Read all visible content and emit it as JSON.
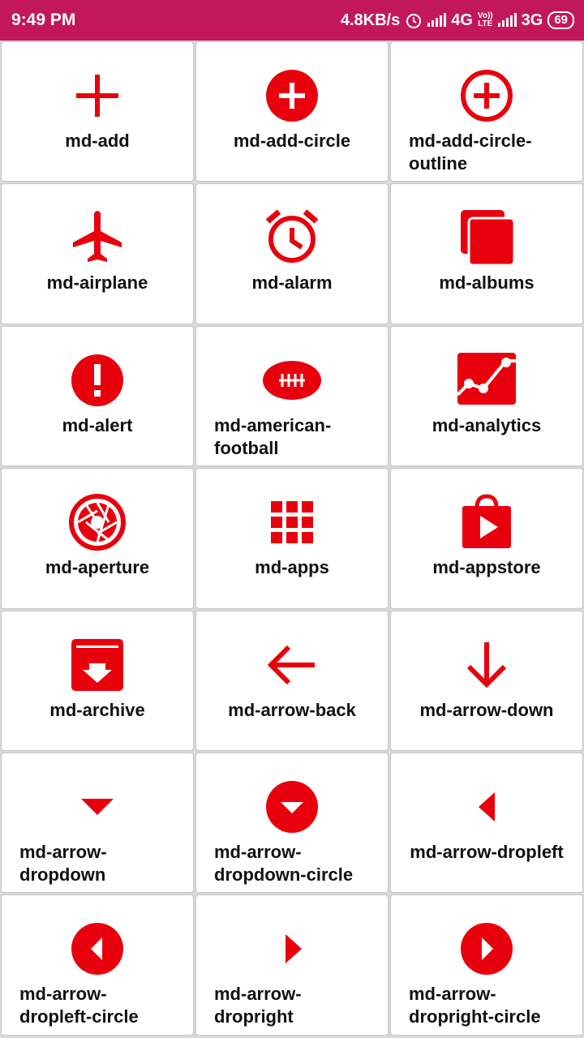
{
  "status_bar": {
    "time": "9:49 PM",
    "net_speed": "4.8KB/s",
    "net1": "4G",
    "volte_top": "Vo))",
    "volte_bottom": "LTE",
    "net2": "3G",
    "battery": "69"
  },
  "accent_color": "#e8000d",
  "icons": [
    {
      "label": "md-add",
      "icon": "add-icon"
    },
    {
      "label": "md-add-circle",
      "icon": "add-circle-icon"
    },
    {
      "label": "md-add-circle-outline",
      "icon": "add-circle-outline-icon"
    },
    {
      "label": "md-airplane",
      "icon": "airplane-icon"
    },
    {
      "label": "md-alarm",
      "icon": "alarm-icon"
    },
    {
      "label": "md-albums",
      "icon": "albums-icon"
    },
    {
      "label": "md-alert",
      "icon": "alert-icon"
    },
    {
      "label": "md-american-football",
      "icon": "american-football-icon"
    },
    {
      "label": "md-analytics",
      "icon": "analytics-icon"
    },
    {
      "label": "md-aperture",
      "icon": "aperture-icon"
    },
    {
      "label": "md-apps",
      "icon": "apps-icon"
    },
    {
      "label": "md-appstore",
      "icon": "appstore-icon"
    },
    {
      "label": "md-archive",
      "icon": "archive-icon"
    },
    {
      "label": "md-arrow-back",
      "icon": "arrow-back-icon"
    },
    {
      "label": "md-arrow-down",
      "icon": "arrow-down-icon"
    },
    {
      "label": "md-arrow-dropdown",
      "icon": "arrow-dropdown-icon"
    },
    {
      "label": "md-arrow-dropdown-circle",
      "icon": "arrow-dropdown-circle-icon"
    },
    {
      "label": "md-arrow-dropleft",
      "icon": "arrow-dropleft-icon"
    },
    {
      "label": "md-arrow-dropleft-circle",
      "icon": "arrow-dropleft-circle-icon"
    },
    {
      "label": "md-arrow-dropright",
      "icon": "arrow-dropright-icon"
    },
    {
      "label": "md-arrow-dropright-circle",
      "icon": "arrow-dropright-circle-icon"
    }
  ]
}
